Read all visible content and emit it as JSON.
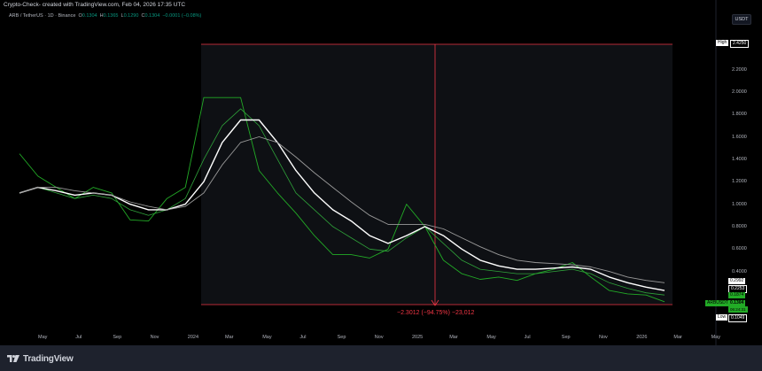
{
  "header": {
    "title": "Crypto-Check- created with TradingView.com, Feb 04, 2026 17:35 UTC"
  },
  "symbol": {
    "name": "ARB / TetherUS · 1D · Binance",
    "o_label": "O",
    "o_value": "0.1304",
    "h_label": "H",
    "h_value": "0.1365",
    "l_label": "L",
    "l_value": "0.1290",
    "c_label": "C",
    "c_value": "0.1304",
    "change": "−0.0001 (−0.08%)"
  },
  "currency": "USDT",
  "price_axis": {
    "ticks": [
      "2.2000",
      "2.0000",
      "1.8000",
      "1.6000",
      "1.4000",
      "1.2000",
      "1.0000",
      "0.8000",
      "0.6000",
      "0.4000"
    ]
  },
  "price_tags": {
    "high_label": "High",
    "high_value": "2.4250",
    "ma1_value": "0.2992",
    "ma2_value": "0.2253",
    "ma3_value": "0.1874",
    "symbol_label": "ARBUSDT",
    "last_value": "0.1304",
    "countdown": "06:24:31",
    "low_label": "Low",
    "low_value": "0.1049"
  },
  "time_axis": {
    "labels": [
      "May",
      "Jul",
      "Sep",
      "Nov",
      "2024",
      "Mar",
      "May",
      "Jul",
      "Sep",
      "Nov",
      "2025",
      "Mar",
      "May",
      "Jul",
      "Sep",
      "Nov",
      "2026",
      "Mar",
      "May"
    ]
  },
  "measure": {
    "text": "−2.3012 (−94.75%) −23,012"
  },
  "footer": {
    "brand": "TradingView"
  },
  "colors": {
    "background": "#000000",
    "price_green": "#22ab26",
    "ma_white": "#ffffff",
    "ma_green": "#2fa33a",
    "ma_gray": "#9a9a9a",
    "measure_red": "#f23645"
  },
  "chart_data": {
    "type": "line",
    "title": "ARB / TetherUS · 1D · Binance",
    "xlabel": "",
    "ylabel": "",
    "ylim": [
      0.1,
      2.45
    ],
    "x": [
      "2023-03",
      "2023-04",
      "2023-05",
      "2023-06",
      "2023-07",
      "2023-08",
      "2023-09",
      "2023-10",
      "2023-11",
      "2023-12",
      "2024-01",
      "2024-02",
      "2024-03",
      "2024-04",
      "2024-05",
      "2024-06",
      "2024-07",
      "2024-08",
      "2024-09",
      "2024-10",
      "2024-11",
      "2024-12",
      "2025-01",
      "2025-02",
      "2025-03",
      "2025-04",
      "2025-05",
      "2025-06",
      "2025-07",
      "2025-08",
      "2025-09",
      "2025-10",
      "2025-11",
      "2025-12",
      "2026-01",
      "2026-02"
    ],
    "series": [
      {
        "values": [
          1.45,
          1.25,
          1.15,
          1.05,
          1.15,
          1.1,
          0.86,
          0.85,
          1.05,
          1.15,
          1.95,
          1.95,
          1.95,
          1.3,
          1.1,
          0.92,
          0.72,
          0.55,
          0.55,
          0.52,
          0.6,
          1.0,
          0.8,
          0.5,
          0.38,
          0.33,
          0.35,
          0.32,
          0.38,
          0.42,
          0.48,
          0.35,
          0.23,
          0.2,
          0.19,
          0.13
        ]
      },
      {
        "values": [
          1.1,
          1.15,
          1.1,
          1.05,
          1.08,
          1.05,
          0.95,
          0.9,
          0.95,
          1.05,
          1.4,
          1.7,
          1.85,
          1.7,
          1.4,
          1.1,
          0.95,
          0.8,
          0.7,
          0.6,
          0.58,
          0.7,
          0.8,
          0.65,
          0.5,
          0.42,
          0.4,
          0.38,
          0.38,
          0.4,
          0.42,
          0.38,
          0.3,
          0.25,
          0.21,
          0.19
        ]
      },
      {
        "values": [
          1.1,
          1.15,
          1.12,
          1.08,
          1.1,
          1.08,
          1.0,
          0.95,
          0.95,
          1.0,
          1.2,
          1.55,
          1.75,
          1.75,
          1.55,
          1.3,
          1.1,
          0.95,
          0.85,
          0.72,
          0.65,
          0.72,
          0.8,
          0.72,
          0.6,
          0.5,
          0.45,
          0.42,
          0.42,
          0.43,
          0.44,
          0.42,
          0.35,
          0.3,
          0.26,
          0.23
        ]
      },
      {
        "values": [
          1.1,
          1.15,
          1.15,
          1.12,
          1.1,
          1.08,
          1.02,
          0.98,
          0.95,
          0.98,
          1.1,
          1.35,
          1.55,
          1.6,
          1.55,
          1.42,
          1.28,
          1.15,
          1.02,
          0.9,
          0.82,
          0.82,
          0.82,
          0.78,
          0.7,
          0.62,
          0.55,
          0.5,
          0.48,
          0.47,
          0.46,
          0.44,
          0.4,
          0.35,
          0.32,
          0.3
        ]
      }
    ]
  }
}
